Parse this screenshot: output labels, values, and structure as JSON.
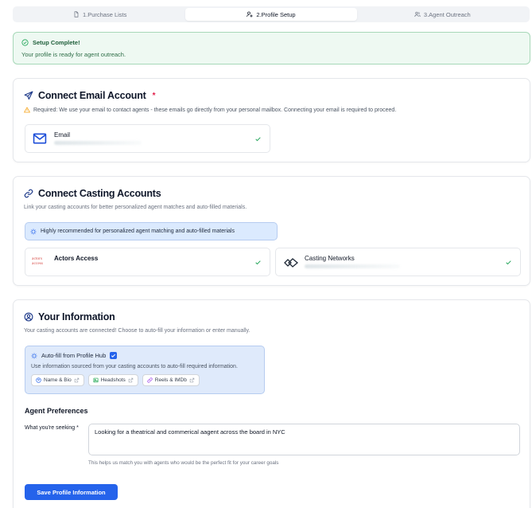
{
  "tabs": [
    {
      "label": "1.Purchase Lists",
      "icon": "file-icon"
    },
    {
      "label": "2.Profile Setup",
      "icon": "user-gear-icon"
    },
    {
      "label": "3.Agent Outreach",
      "icon": "users-icon"
    }
  ],
  "success": {
    "title": "Setup Complete!",
    "description": "Your profile is ready for agent outreach."
  },
  "email_section": {
    "title": "Connect Email Account",
    "required_star": "*",
    "warning": "Required: We use your email to contact agents - these emails go directly from your personal mailbox. Connecting your email is required to proceed.",
    "account_label": "Email",
    "icon": "mail-icon"
  },
  "casting_section": {
    "title": "Connect Casting Accounts",
    "description": "Link your casting accounts for better personalized agent matches and auto-filled materials.",
    "hint": "Highly recommended for personalized agent matching and auto-filled materials",
    "accounts": [
      {
        "label": "Actors Access",
        "logo_text_1": "actors",
        "logo_text_2": "access"
      },
      {
        "label": "Casting Networks"
      }
    ]
  },
  "info_section": {
    "title": "Your Information",
    "description": "Your casting accounts are connected! Choose to auto-fill your information or enter manually.",
    "autofill": {
      "title": "Auto-fill from Profile Hub",
      "checked": true,
      "description": "Use information sourced from your casting accounts to auto-fill required information.",
      "chips": [
        {
          "label": "Name & Bio",
          "icon": "person-icon"
        },
        {
          "label": "Headshots",
          "icon": "image-icon"
        },
        {
          "label": "Reels & IMDb",
          "icon": "link-icon"
        }
      ]
    },
    "preferences_title": "Agent Preferences",
    "seeking_label": "What you're seeking *",
    "seeking_value": "Looking for a theatrical and commerical aagent across the board in NYC",
    "seeking_help": "This helps us match you with agents who would be the perfect fit for your career goals",
    "save_label": "Save Profile Information"
  },
  "colors": {
    "accent": "#2563eb",
    "success": "#22a559",
    "warning": "#f59e0b",
    "actors_access_red": "#d9534f"
  }
}
